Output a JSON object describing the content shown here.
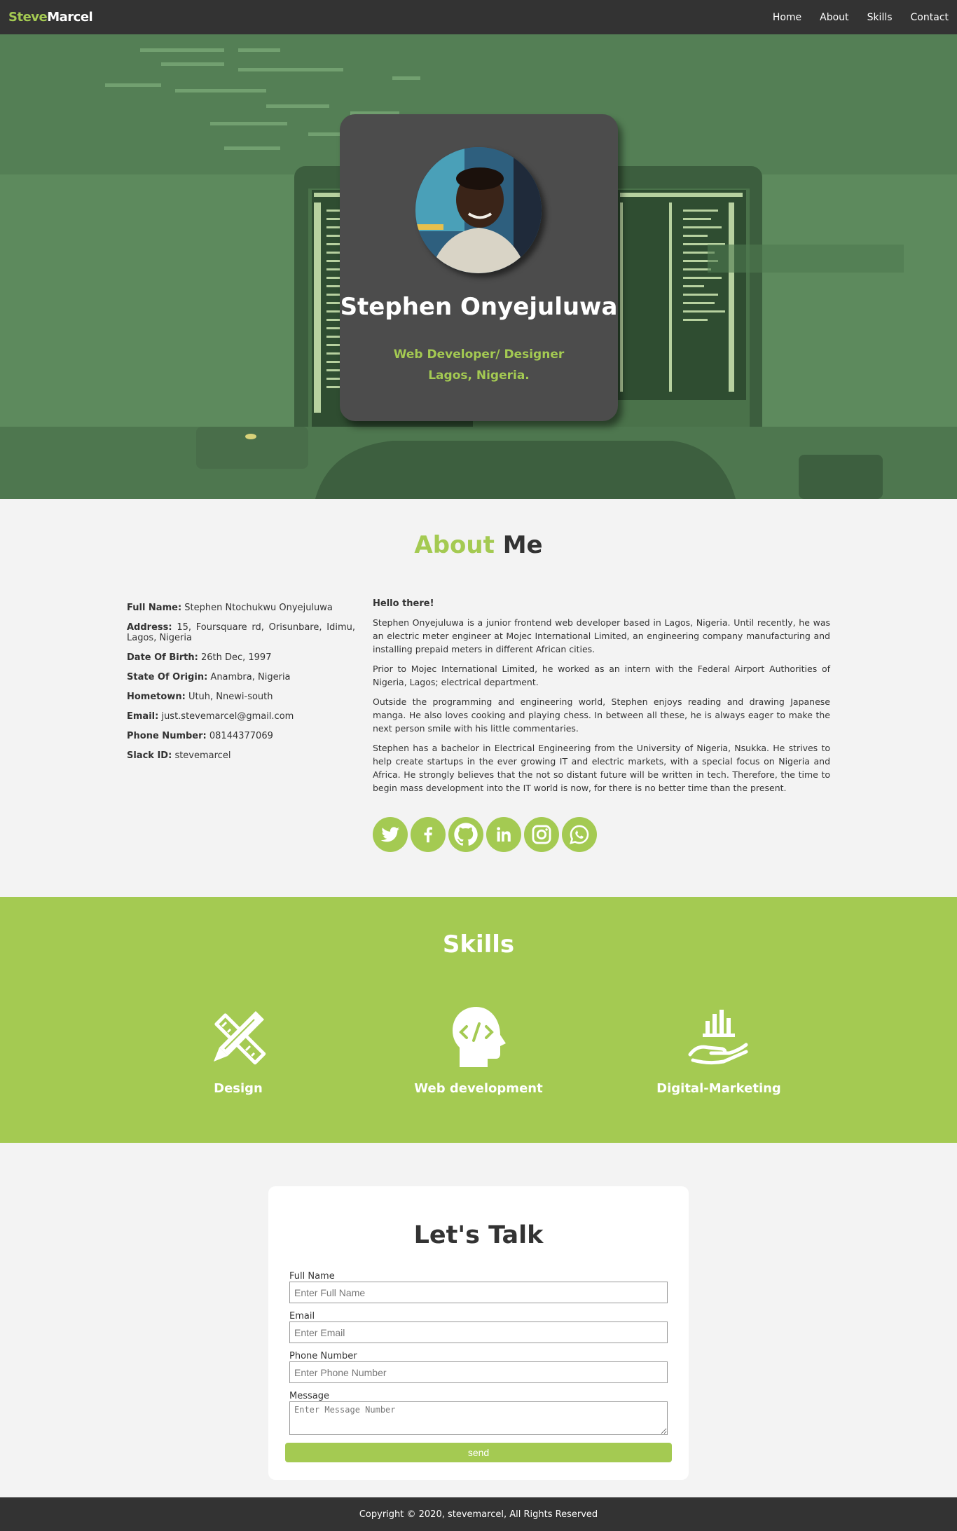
{
  "nav": {
    "brand_first": "Steve",
    "brand_second": "Marcel",
    "links": [
      "Home",
      "About",
      "Skills",
      "Contact"
    ]
  },
  "hero": {
    "name": "Stephen Onyejuluwa",
    "role": "Web Developer/ Designer",
    "location": "Lagos, Nigeria."
  },
  "about": {
    "title_accent": "About",
    "title_rest": "Me",
    "info": [
      {
        "label": "Full Name:",
        "value": "Stephen Ntochukwu Onyejuluwa"
      },
      {
        "label": "Address:",
        "value": "15, Foursquare rd, Orisunbare, Idimu, Lagos, Nigeria"
      },
      {
        "label": "Date Of Birth:",
        "value": "26th Dec, 1997"
      },
      {
        "label": "State Of Origin:",
        "value": "Anambra, Nigeria"
      },
      {
        "label": "Hometown:",
        "value": "Utuh, Nnewi-south"
      },
      {
        "label": "Email:",
        "value": "just.stevemarcel@gmail.com"
      },
      {
        "label": "Phone Number:",
        "value": "08144377069"
      },
      {
        "label": "Slack ID:",
        "value": "stevemarcel"
      }
    ],
    "greeting": "Hello there!",
    "paragraphs": [
      "Stephen Onyejuluwa is a junior frontend web developer based in Lagos, Nigeria. Until recently, he was an electric meter engineer at Mojec International Limited, an engineering company manufacturing and installing prepaid meters in different African cities.",
      "Prior to Mojec International Limited, he worked as an intern with the Federal Airport Authorities of Nigeria, Lagos; electrical department.",
      "Outside the programming and engineering world, Stephen enjoys reading and drawing Japanese manga. He also loves cooking and playing chess. In between all these, he is always eager to make the next person smile with his little commentaries.",
      "Stephen has a bachelor in Electrical Engineering from the University of Nigeria, Nsukka. He strives to help create startups in the ever growing IT and electric markets, with a special focus on Nigeria and Africa. He strongly believes that the not so distant future will be written in tech. Therefore, the time to begin mass development into the IT world is now, for there is no better time than the present."
    ],
    "socials": [
      "twitter-icon",
      "facebook-icon",
      "github-icon",
      "linkedin-icon",
      "instagram-icon",
      "whatsapp-icon"
    ]
  },
  "skills": {
    "title": "Skills",
    "items": [
      {
        "label": "Design",
        "icon": "design-tools-icon"
      },
      {
        "label": "Web development",
        "icon": "code-head-icon"
      },
      {
        "label": "Digital-Marketing",
        "icon": "growth-hand-icon"
      }
    ]
  },
  "contact": {
    "title": "Let's Talk",
    "fields": [
      {
        "label": "Full Name",
        "placeholder": "Enter Full Name"
      },
      {
        "label": "Email",
        "placeholder": "Enter Email"
      },
      {
        "label": "Phone Number",
        "placeholder": "Enter Phone Number"
      },
      {
        "label": "Message",
        "placeholder": "Enter Message Number"
      }
    ],
    "send_label": "send"
  },
  "footer": {
    "text": "Copyright © 2020, stevemarcel, All Rights Reserved"
  },
  "colors": {
    "accent": "#a4ca52",
    "dark": "#333333",
    "card": "#4c4c4c"
  }
}
